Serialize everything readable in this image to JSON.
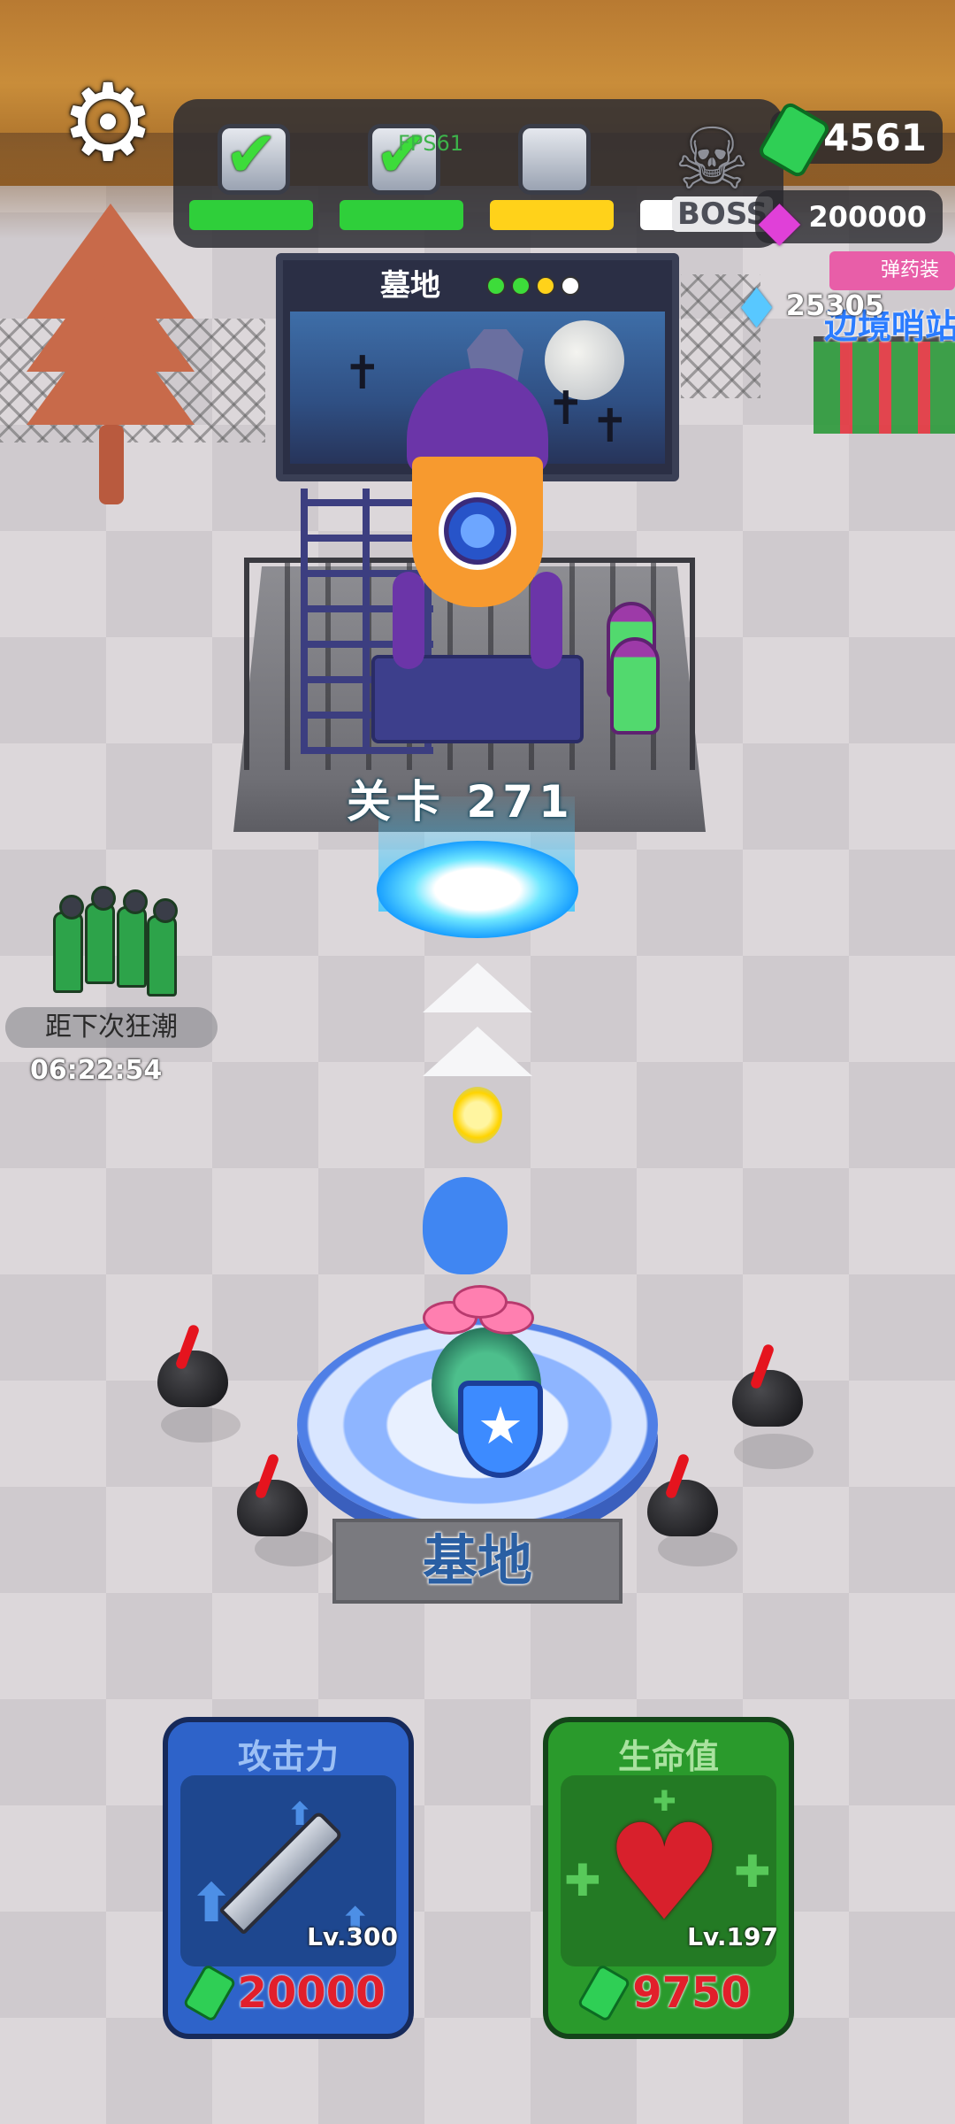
{
  "hud": {
    "settings_icon": "gear-icon",
    "fps_text": "FPS61",
    "stages": [
      {
        "state": "complete",
        "bar_color": "#2fcf3a",
        "icon": "check-icon"
      },
      {
        "state": "complete",
        "bar_color": "#2fcf3a",
        "icon": "check-icon"
      },
      {
        "state": "current",
        "bar_color": "#ffd21a",
        "icon": "chest-icon"
      },
      {
        "state": "boss",
        "bar_color": "#ffffff",
        "icon": "skull-icon",
        "label": "BOSS"
      }
    ],
    "currencies": {
      "cash": {
        "value": "4561",
        "icon": "cash-icon"
      },
      "gems": {
        "value": "200000",
        "icon": "gem-icon"
      },
      "crystals": {
        "value": "25305",
        "icon": "crystal-icon"
      }
    }
  },
  "side_sign": {
    "tag": "弹药装",
    "title": "边境哨站"
  },
  "billboard": {
    "title": "墓地",
    "progress_dots": [
      "#3ddc3a",
      "#3ddc3a",
      "#ffd21a",
      "#ffffff"
    ]
  },
  "level": {
    "label": "关卡 271"
  },
  "wave": {
    "label": "距下次狂潮",
    "timer": "06:22:54"
  },
  "base": {
    "label": "基地"
  },
  "upgrades": [
    {
      "id": "attack",
      "title": "攻击力",
      "level": "Lv.300",
      "cost": "20000",
      "art": "sword-icon"
    },
    {
      "id": "health",
      "title": "生命值",
      "level": "Lv.197",
      "cost": "9750",
      "art": "heart-icon"
    }
  ],
  "colors": {
    "attack_card": "#2e63c9",
    "health_card": "#2a9a2c",
    "cost_text": "#e21f2b",
    "base_blue": "#4f7fe6"
  }
}
